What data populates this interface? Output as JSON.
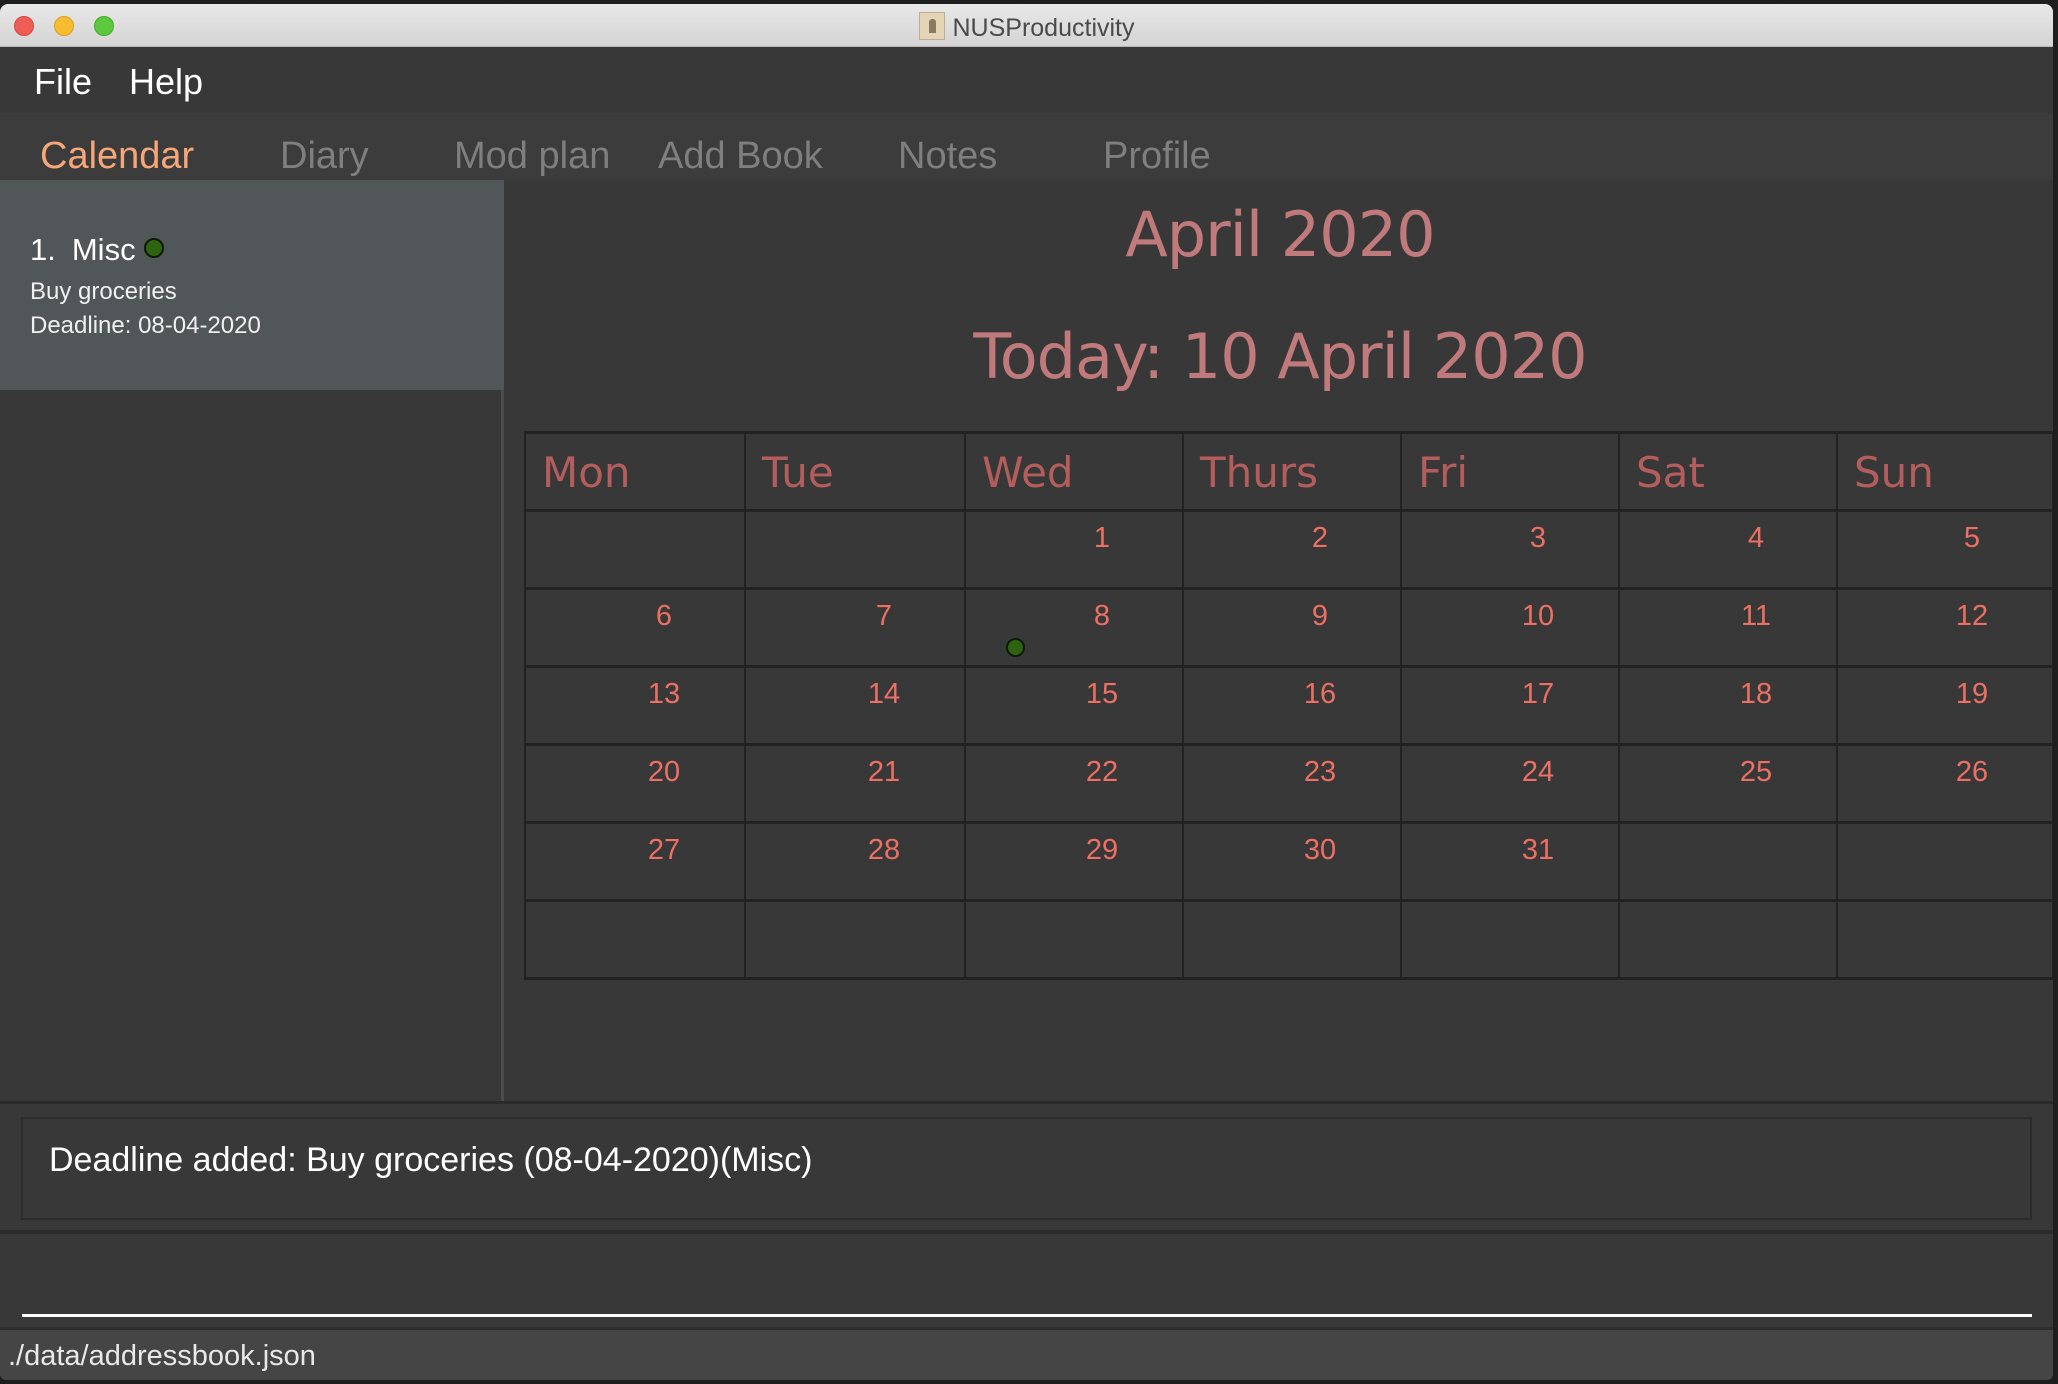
{
  "window": {
    "title": "NUSProductivity",
    "app_icon": "address-card-icon"
  },
  "menu": {
    "items": [
      {
        "label": "File"
      },
      {
        "label": "Help"
      }
    ]
  },
  "tabs": [
    {
      "label": "Calendar",
      "active": true
    },
    {
      "label": "Diary",
      "active": false
    },
    {
      "label": "Mod plan",
      "active": false
    },
    {
      "label": "Add Book",
      "active": false
    },
    {
      "label": "Notes",
      "active": false
    },
    {
      "label": "Profile",
      "active": false
    }
  ],
  "sidebar": {
    "deadlines": [
      {
        "index": "1.",
        "category": "Misc",
        "category_color": "#2e6410",
        "description": "Buy groceries",
        "deadline": "Deadline: 08-04-2020"
      }
    ]
  },
  "calendar": {
    "month_title": "April 2020",
    "today_label": "Today: 10 April 2020",
    "weekdays": [
      "Mon",
      "Tue",
      "Wed",
      "Thurs",
      "Fri",
      "Sat",
      "Sun"
    ],
    "weeks": [
      [
        "",
        "",
        "1",
        "2",
        "3",
        "4",
        "5"
      ],
      [
        "6",
        "7",
        "8",
        "9",
        "10",
        "11",
        "12"
      ],
      [
        "13",
        "14",
        "15",
        "16",
        "17",
        "18",
        "19"
      ],
      [
        "20",
        "21",
        "22",
        "23",
        "24",
        "25",
        "26"
      ],
      [
        "27",
        "28",
        "29",
        "30",
        "31",
        "",
        ""
      ],
      [
        "",
        "",
        "",
        "",
        "",
        "",
        ""
      ]
    ],
    "event_markers": [
      {
        "day": "8",
        "color": "#2e6410"
      }
    ],
    "colors": {
      "title": "#c17a7b",
      "weekday": "#b35e5d",
      "day_number": "#ec7063"
    }
  },
  "result": {
    "message": "Deadline added: Buy groceries (08-04-2020)(Misc)"
  },
  "command": {
    "value": "",
    "placeholder": ""
  },
  "status_bar": {
    "path": "./data/addressbook.json"
  },
  "theme": {
    "active_tab": "#f7a679",
    "inactive_tab": "#7f7f7f"
  }
}
